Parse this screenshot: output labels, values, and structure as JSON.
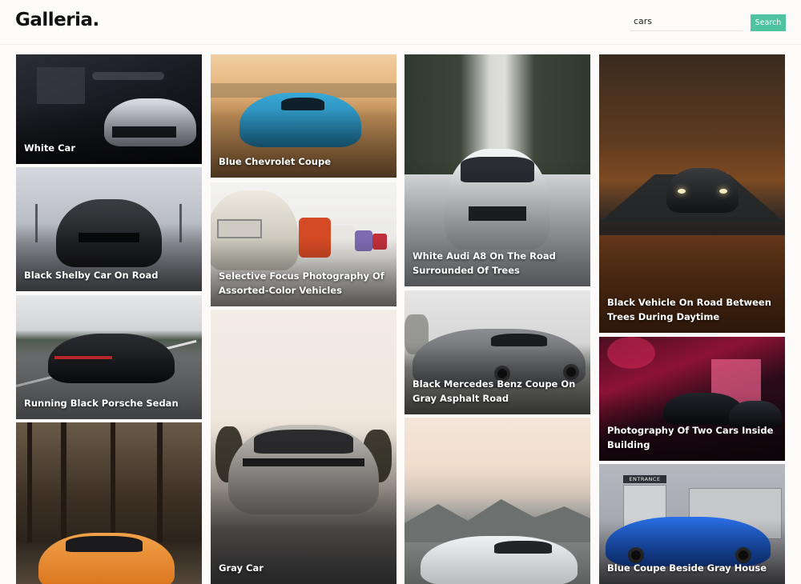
{
  "app": {
    "title": "Galleria."
  },
  "search": {
    "value": "cars",
    "button_label": "Search"
  },
  "gallery": {
    "photos": [
      {
        "caption": "White Car"
      },
      {
        "caption": "Black Shelby Car On Road"
      },
      {
        "caption": "Running Black Porsche Sedan"
      },
      {
        "caption": ""
      },
      {
        "caption": "Blue Chevrolet Coupe"
      },
      {
        "caption": "Selective Focus Photography Of Assorted-Color Vehicles"
      },
      {
        "caption": "Gray Car"
      },
      {
        "caption": "White Audi A8 On The Road Surrounded Of Trees"
      },
      {
        "caption": "Black Mercedes Benz Coupe On Gray Asphalt Road"
      },
      {
        "caption": ""
      },
      {
        "caption": "Black Vehicle On Road Between Trees During Daytime"
      },
      {
        "caption": "Photography Of Two Cars Inside Building"
      },
      {
        "caption": "Blue Coupe Beside Gray House"
      }
    ]
  },
  "signage": {
    "entrance": "ENTRANCE"
  },
  "colors": {
    "accent": "#4fc3a1",
    "background": "#fcfbf9"
  }
}
